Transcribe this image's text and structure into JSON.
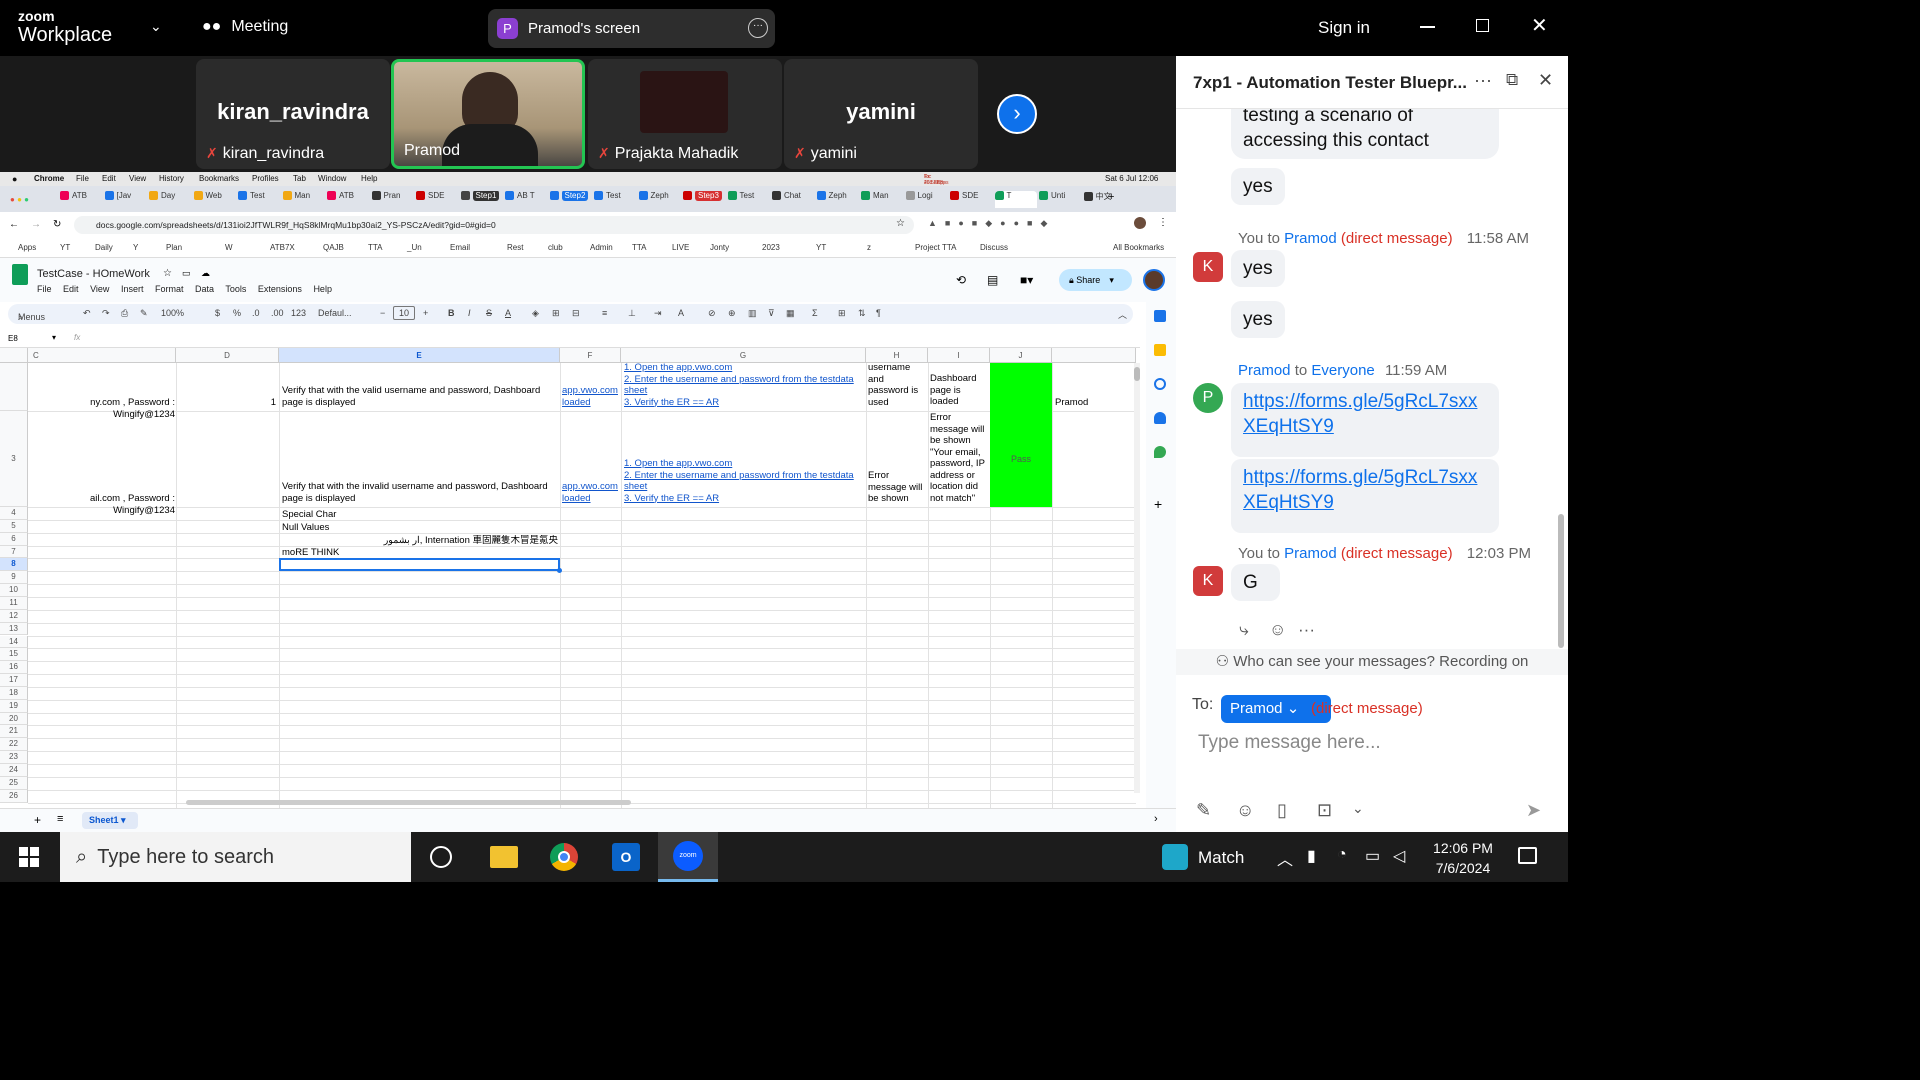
{
  "zoom": {
    "logo_top": "zoom",
    "logo_bottom": "Workplace",
    "meeting_label": "Meeting",
    "screen_label": "Pramod's screen",
    "signin": "Sign in"
  },
  "participants": [
    {
      "big": "kiran_ravindra",
      "name": "kiran_ravindra"
    },
    {
      "big": "",
      "name": "Pramod"
    },
    {
      "big": "",
      "name": "Prajakta Mahadik"
    },
    {
      "big": "yamini",
      "name": "yamini"
    }
  ],
  "mac": {
    "menus": [
      "Chrome",
      "File",
      "Edit",
      "View",
      "History",
      "Bookmarks",
      "Profiles",
      "Tab",
      "Window",
      "Help"
    ],
    "clock": "Sat 6 Jul 12:06",
    "net_tx": "Tx: 268.0KBps",
    "net_rx": "Rx: 40.5KBps"
  },
  "tabs": [
    "ATB",
    "[Jav",
    "Day",
    "Web",
    "Test",
    "Man",
    "ATB",
    "Pran",
    "SDE",
    "Step1",
    "AB T",
    "Step2",
    "Test",
    "Zeph",
    "Step3",
    "Test",
    "Chat",
    "Zeph",
    "Man",
    "Logi",
    "SDE",
    "T",
    "Unti",
    "中文"
  ],
  "url": "docs.google.com/spreadsheets/d/131ioi2JfTWLR9f_HqS8klMrqMu1bp30ai2_YS-PSCzA/edit?gid=0#gid=0",
  "bookmarks": [
    "Apps",
    "YT",
    "Daily",
    "Y",
    "Plan",
    "W",
    "ATB7X",
    "QAJB",
    "TTA",
    "_Un",
    "Email",
    "Rest",
    "club",
    "Admin",
    "TTA",
    "LIVE",
    "Jonty",
    "2023",
    "YT",
    "z",
    "Project TTA",
    "Discuss",
    "All Bookmarks"
  ],
  "sheets": {
    "doc_title": "TestCase - HOmeWork",
    "menu": [
      "File",
      "Edit",
      "View",
      "Insert",
      "Format",
      "Data",
      "Tools",
      "Extensions",
      "Help"
    ],
    "share_label": "Share",
    "toolbar": {
      "menus": "Menus",
      "zoom": "100%",
      "dollar": "$",
      "percent": "%",
      "dec_down": ".0",
      "dec_up": ".00",
      "num": "123",
      "font": "Defaul...",
      "size": "10"
    },
    "cell_ref": "E8",
    "fx": "fx",
    "col_letters": [
      "C",
      "D",
      "E",
      "F",
      "G",
      "H",
      "I",
      "J"
    ],
    "row_numbers": [
      "",
      "3",
      "4",
      "5",
      "6",
      "7",
      "8",
      "9",
      "10",
      "11",
      "12",
      "13",
      "14",
      "15",
      "16",
      "17",
      "18",
      "19",
      "20",
      "21",
      "22",
      "23",
      "24",
      "25",
      "26"
    ],
    "r2": {
      "c": "ny.com , Password : Wingify@1234",
      "d": "1",
      "e": "Verify that with the valid username and password, Dashboard page is displayed",
      "f": "app.vwo.com loaded",
      "g": [
        "1. Open the app.vwo.com",
        "2. Enter the username and password from the testdata sheet",
        "3. Verify the ER == AR"
      ],
      "h": "username and password is used",
      "i": "Dashboard page is loaded",
      "k": "Pramod"
    },
    "r3": {
      "c": "ail.com , Password : Wingify@1234",
      "e": "Verify that with the invalid username and password, Dashboard page is displayed",
      "f": "app.vwo.com loaded",
      "g": [
        "1. Open the app.vwo.com",
        "2. Enter the username and password from the testdata sheet",
        "3. Verify the ER == AR"
      ],
      "h": "Error message will be shown",
      "i": "Error message will be shown \"Your email, password, IP address or location did not match\"",
      "j": "Pass"
    },
    "r4": "Special Char",
    "r5": "Null Values",
    "r6": "ار بشمور, Internation 車固麗隻木冒是氪央",
    "r7": "moRE THINK",
    "sheet_tab": "Sheet1"
  },
  "chat": {
    "title": "7xp1 - Automation Tester Bluepr...",
    "msg0": "testing a scenario of accessing this contact",
    "msg1": "yes",
    "m2_from": "You to",
    "m2_to": "Pramod",
    "m2_dm": "(direct message)",
    "m2_time": "11:58 AM",
    "msg2a": "yes",
    "msg2b": "yes",
    "m3_from": "Pramod",
    "m3_to": "to",
    "m3_all": "Everyone",
    "m3_time": "11:59 AM",
    "link": "https://forms.gle/5gRcL7sxxXEqHtSY9",
    "m4_from": "You to",
    "m4_to": "Pramod",
    "m4_dm": "(direct message)",
    "m4_time": "12:03 PM",
    "msg4": "G",
    "avatar_k": "K",
    "avatar_p": "P",
    "visibility": "Who can see your messages? Recording on",
    "to_label": "To:",
    "to_target": "Pramod",
    "to_dm": "(direct message)",
    "placeholder": "Type message here..."
  },
  "taskbar": {
    "search": "Type here to search",
    "weather": "Match",
    "time": "12:06 PM",
    "date": "7/6/2024"
  }
}
